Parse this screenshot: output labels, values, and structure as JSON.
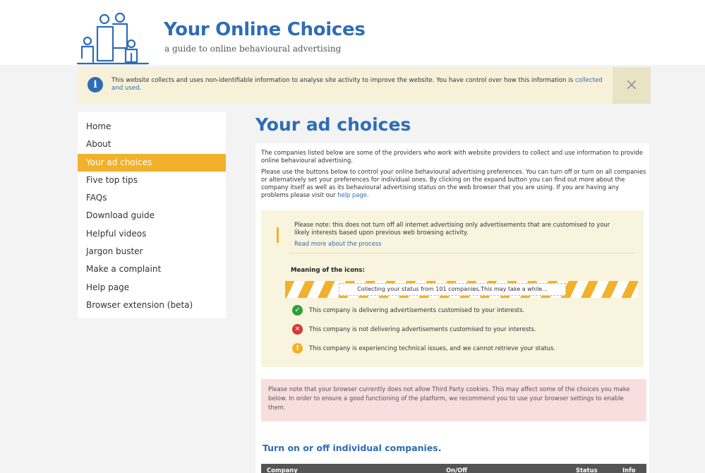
{
  "header": {
    "title": "Your Online Choices",
    "subtitle": "a guide to online behavioural advertising"
  },
  "cookie_notice": {
    "text": "This website collects and uses non-identifiable information to analyse site activity to improve the website. You have control over how this information is",
    "link": "collected and used",
    "text_end": ".",
    "close": "×"
  },
  "sidebar": {
    "items": [
      {
        "label": "Home"
      },
      {
        "label": "About"
      },
      {
        "label": "Your ad choices"
      },
      {
        "label": "Five top tips"
      },
      {
        "label": "FAQs"
      },
      {
        "label": "Download guide"
      },
      {
        "label": "Helpful videos"
      },
      {
        "label": "Jargon buster"
      },
      {
        "label": "Make a complaint"
      },
      {
        "label": "Help page"
      },
      {
        "label": "Browser extension (beta)"
      }
    ]
  },
  "main": {
    "heading": "Your ad choices",
    "intro": "The companies listed below are some of the providers who work with website providers to collect and use information to provide online behavioural advertising.",
    "instructions": "Please use the buttons below to control your online behavioural advertising preferences. You can turn off or turn on all companies or alternatively set your preferences for individual ones. By clicking on the expand button you can find out more about the company itself as well as its behavioural advertising status on the web browser that you are using. If you are having any problems please visit our",
    "help_link": "help page.",
    "note": {
      "text": "Please note: this does not turn off all internet advertising only advertisements that are customised to your likely interests based upon previous web browsing activity.",
      "link": "Read more about the process",
      "icons_heading": "Meaning of the icons:",
      "progress_text": "Collecting your status from 101 companies.This may take a while...",
      "legend": [
        {
          "icon": "check-icon",
          "color": "#2e9e3a",
          "glyph": "✓",
          "text": "This company is delivering advertisements customised to your interests."
        },
        {
          "icon": "cross-icon",
          "color": "#d93434",
          "glyph": "✕",
          "text": "This company is not delivering advertisements customised to your interests."
        },
        {
          "icon": "warning-icon",
          "color": "#f2b12a",
          "glyph": "!",
          "text": "This company is experiencing technical issues, and we cannot retrieve your status."
        }
      ]
    },
    "cookie_warning": "Please note that your browser currently does not allow Third Party cookies. This may affect some of the choices you make below. In order to ensure a good functioning of the platform, we recommend you to use your browser settings to enable them.",
    "companies_heading": "Turn on or off individual companies.",
    "table_headers": {
      "company": "Company",
      "on_off": "On/Off",
      "status": "Status",
      "info": "Info"
    }
  },
  "colors": {
    "brand_blue": "#2e6db5",
    "accent_orange": "#f2b12a"
  }
}
